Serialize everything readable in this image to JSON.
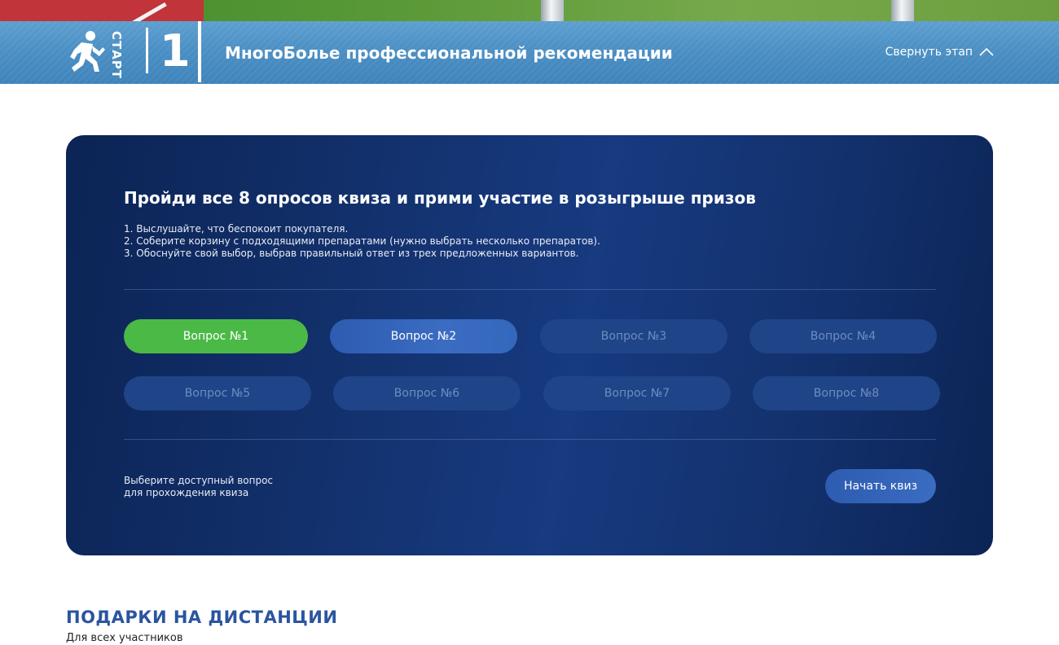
{
  "stage": {
    "start_label": "СТАРТ",
    "number": "1",
    "title": "МногоБолье профессиональной рекомендации",
    "collapse_label": "Свернуть этап"
  },
  "quiz": {
    "title": "Пройди все 8 опросов квиза и прими участие в розыгрыше призов",
    "steps": [
      "1. Выслушайте, что беспокоит покупателя.",
      "2. Соберите корзину с подходящими препаратами (нужно выбрать несколько препаратов).",
      "3. Обоснуйте свой выбор, выбрав правильный ответ из трех предложенных вариантов."
    ],
    "questions": [
      {
        "label": "Вопрос №1",
        "state": "active"
      },
      {
        "label": "Вопрос №2",
        "state": "available"
      },
      {
        "label": "Вопрос №3",
        "state": "locked"
      },
      {
        "label": "Вопрос №4",
        "state": "locked"
      },
      {
        "label": "Вопрос №5",
        "state": "locked"
      },
      {
        "label": "Вопрос №6",
        "state": "locked"
      },
      {
        "label": "Вопрос №7",
        "state": "locked"
      },
      {
        "label": "Вопрос №8",
        "state": "locked"
      }
    ],
    "hint_line1": "Выберите доступный вопрос",
    "hint_line2": "для прохождения квиза",
    "start_button": "Начать квиз"
  },
  "gifts": {
    "title": "ПОДАРКИ НА ДИСТАНЦИИ",
    "subtitle": "Для всех участников"
  },
  "colors": {
    "stage_bar": "#4a8ec3",
    "card_bg": "#12306b",
    "active": "#4bb946",
    "available": "#3468bd",
    "locked": "#1f4488",
    "gifts_title": "#2a55a0"
  }
}
